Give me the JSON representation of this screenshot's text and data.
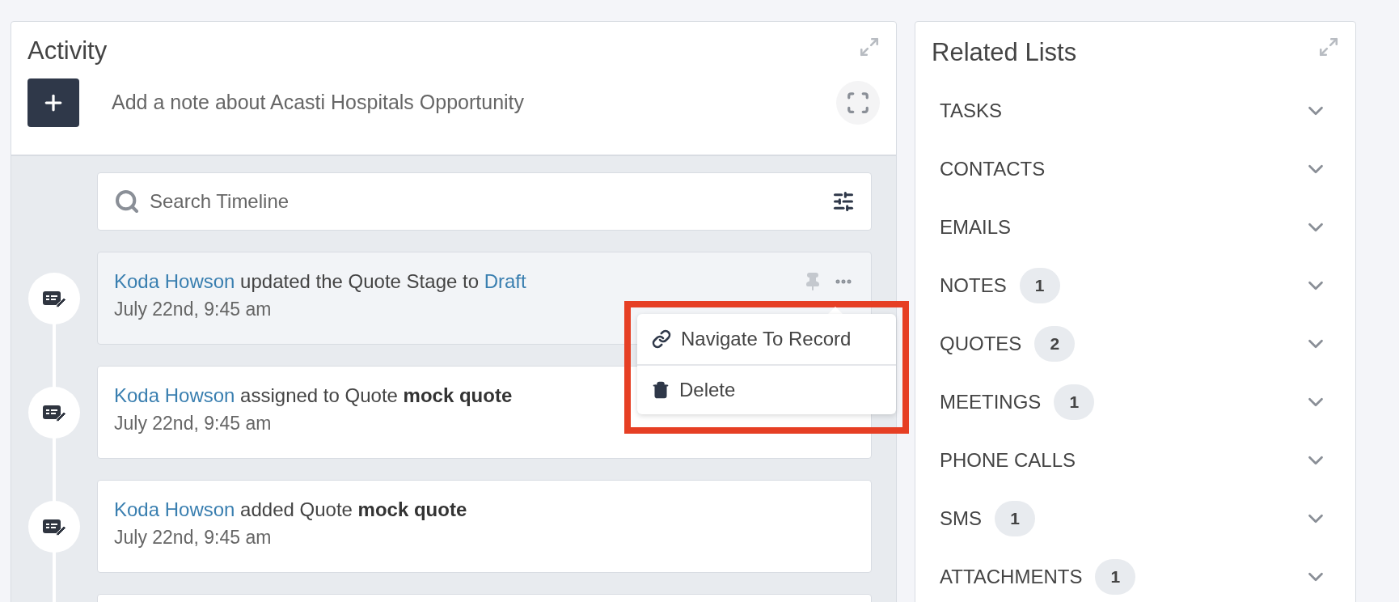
{
  "activity": {
    "title": "Activity",
    "note_placeholder": "Add a note about Acasti Hospitals Opportunity",
    "search": {
      "placeholder": "Search Timeline"
    },
    "entries": [
      {
        "actor": "Koda Howson",
        "action": "updated the Quote Stage to",
        "target": "Draft",
        "kind": "link",
        "time": "July 22nd, 9:45 am",
        "highlighted": true
      },
      {
        "actor": "Koda Howson",
        "action": "assigned to Quote",
        "target": "mock quote",
        "kind": "bold",
        "time": "July 22nd, 9:45 am",
        "highlighted": false
      },
      {
        "actor": "Koda Howson",
        "action": "added Quote",
        "target": "mock quote",
        "kind": "bold",
        "time": "July 22nd, 9:45 am",
        "highlighted": false
      }
    ]
  },
  "menu": {
    "items": [
      {
        "label": "Navigate To Record",
        "kind": "link"
      },
      {
        "label": "Delete",
        "kind": "delete"
      }
    ]
  },
  "related_lists": {
    "title": "Related Lists",
    "items": [
      {
        "label": "TASKS"
      },
      {
        "label": "CONTACTS"
      },
      {
        "label": "EMAILS"
      },
      {
        "label": "NOTES",
        "count": "1"
      },
      {
        "label": "QUOTES",
        "count": "2"
      },
      {
        "label": "MEETINGS",
        "count": "1"
      },
      {
        "label": "PHONE CALLS"
      },
      {
        "label": "SMS",
        "count": "1"
      },
      {
        "label": "ATTACHMENTS",
        "count": "1"
      }
    ]
  }
}
